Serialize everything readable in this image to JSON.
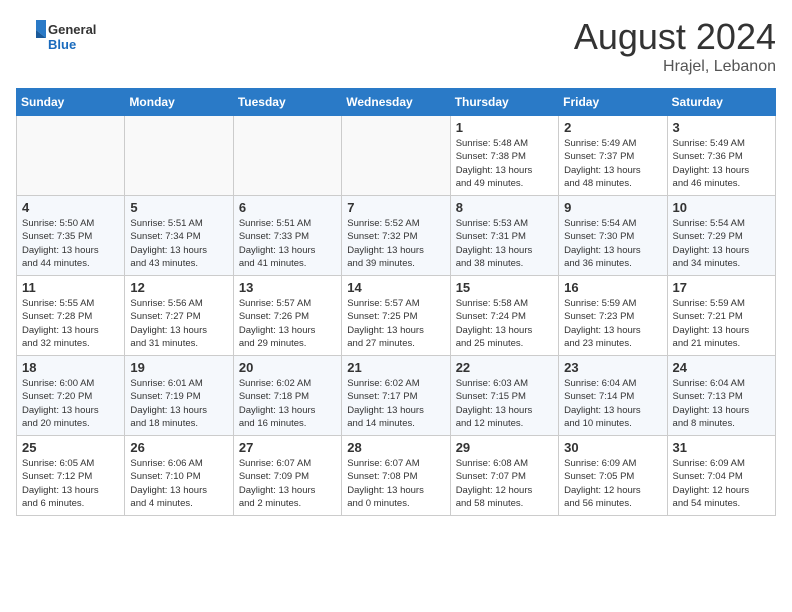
{
  "header": {
    "logo_general": "General",
    "logo_blue": "Blue",
    "month_year": "August 2024",
    "location": "Hrajel, Lebanon"
  },
  "days_of_week": [
    "Sunday",
    "Monday",
    "Tuesday",
    "Wednesday",
    "Thursday",
    "Friday",
    "Saturday"
  ],
  "weeks": [
    [
      {
        "day": "",
        "info": ""
      },
      {
        "day": "",
        "info": ""
      },
      {
        "day": "",
        "info": ""
      },
      {
        "day": "",
        "info": ""
      },
      {
        "day": "1",
        "info": "Sunrise: 5:48 AM\nSunset: 7:38 PM\nDaylight: 13 hours\nand 49 minutes."
      },
      {
        "day": "2",
        "info": "Sunrise: 5:49 AM\nSunset: 7:37 PM\nDaylight: 13 hours\nand 48 minutes."
      },
      {
        "day": "3",
        "info": "Sunrise: 5:49 AM\nSunset: 7:36 PM\nDaylight: 13 hours\nand 46 minutes."
      }
    ],
    [
      {
        "day": "4",
        "info": "Sunrise: 5:50 AM\nSunset: 7:35 PM\nDaylight: 13 hours\nand 44 minutes."
      },
      {
        "day": "5",
        "info": "Sunrise: 5:51 AM\nSunset: 7:34 PM\nDaylight: 13 hours\nand 43 minutes."
      },
      {
        "day": "6",
        "info": "Sunrise: 5:51 AM\nSunset: 7:33 PM\nDaylight: 13 hours\nand 41 minutes."
      },
      {
        "day": "7",
        "info": "Sunrise: 5:52 AM\nSunset: 7:32 PM\nDaylight: 13 hours\nand 39 minutes."
      },
      {
        "day": "8",
        "info": "Sunrise: 5:53 AM\nSunset: 7:31 PM\nDaylight: 13 hours\nand 38 minutes."
      },
      {
        "day": "9",
        "info": "Sunrise: 5:54 AM\nSunset: 7:30 PM\nDaylight: 13 hours\nand 36 minutes."
      },
      {
        "day": "10",
        "info": "Sunrise: 5:54 AM\nSunset: 7:29 PM\nDaylight: 13 hours\nand 34 minutes."
      }
    ],
    [
      {
        "day": "11",
        "info": "Sunrise: 5:55 AM\nSunset: 7:28 PM\nDaylight: 13 hours\nand 32 minutes."
      },
      {
        "day": "12",
        "info": "Sunrise: 5:56 AM\nSunset: 7:27 PM\nDaylight: 13 hours\nand 31 minutes."
      },
      {
        "day": "13",
        "info": "Sunrise: 5:57 AM\nSunset: 7:26 PM\nDaylight: 13 hours\nand 29 minutes."
      },
      {
        "day": "14",
        "info": "Sunrise: 5:57 AM\nSunset: 7:25 PM\nDaylight: 13 hours\nand 27 minutes."
      },
      {
        "day": "15",
        "info": "Sunrise: 5:58 AM\nSunset: 7:24 PM\nDaylight: 13 hours\nand 25 minutes."
      },
      {
        "day": "16",
        "info": "Sunrise: 5:59 AM\nSunset: 7:23 PM\nDaylight: 13 hours\nand 23 minutes."
      },
      {
        "day": "17",
        "info": "Sunrise: 5:59 AM\nSunset: 7:21 PM\nDaylight: 13 hours\nand 21 minutes."
      }
    ],
    [
      {
        "day": "18",
        "info": "Sunrise: 6:00 AM\nSunset: 7:20 PM\nDaylight: 13 hours\nand 20 minutes."
      },
      {
        "day": "19",
        "info": "Sunrise: 6:01 AM\nSunset: 7:19 PM\nDaylight: 13 hours\nand 18 minutes."
      },
      {
        "day": "20",
        "info": "Sunrise: 6:02 AM\nSunset: 7:18 PM\nDaylight: 13 hours\nand 16 minutes."
      },
      {
        "day": "21",
        "info": "Sunrise: 6:02 AM\nSunset: 7:17 PM\nDaylight: 13 hours\nand 14 minutes."
      },
      {
        "day": "22",
        "info": "Sunrise: 6:03 AM\nSunset: 7:15 PM\nDaylight: 13 hours\nand 12 minutes."
      },
      {
        "day": "23",
        "info": "Sunrise: 6:04 AM\nSunset: 7:14 PM\nDaylight: 13 hours\nand 10 minutes."
      },
      {
        "day": "24",
        "info": "Sunrise: 6:04 AM\nSunset: 7:13 PM\nDaylight: 13 hours\nand 8 minutes."
      }
    ],
    [
      {
        "day": "25",
        "info": "Sunrise: 6:05 AM\nSunset: 7:12 PM\nDaylight: 13 hours\nand 6 minutes."
      },
      {
        "day": "26",
        "info": "Sunrise: 6:06 AM\nSunset: 7:10 PM\nDaylight: 13 hours\nand 4 minutes."
      },
      {
        "day": "27",
        "info": "Sunrise: 6:07 AM\nSunset: 7:09 PM\nDaylight: 13 hours\nand 2 minutes."
      },
      {
        "day": "28",
        "info": "Sunrise: 6:07 AM\nSunset: 7:08 PM\nDaylight: 13 hours\nand 0 minutes."
      },
      {
        "day": "29",
        "info": "Sunrise: 6:08 AM\nSunset: 7:07 PM\nDaylight: 12 hours\nand 58 minutes."
      },
      {
        "day": "30",
        "info": "Sunrise: 6:09 AM\nSunset: 7:05 PM\nDaylight: 12 hours\nand 56 minutes."
      },
      {
        "day": "31",
        "info": "Sunrise: 6:09 AM\nSunset: 7:04 PM\nDaylight: 12 hours\nand 54 minutes."
      }
    ]
  ]
}
